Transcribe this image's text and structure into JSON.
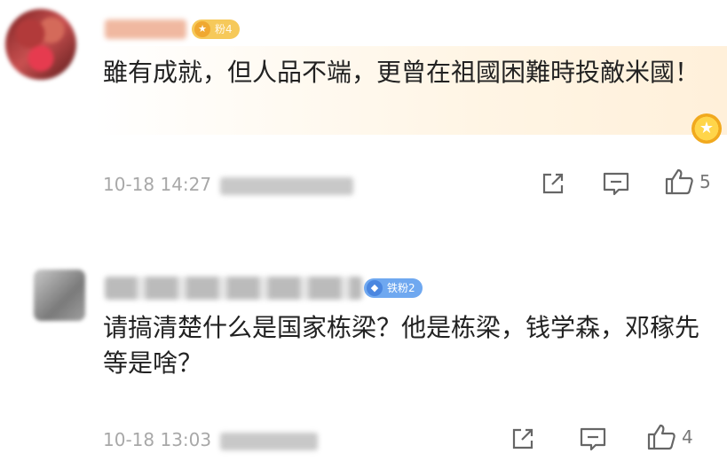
{
  "comments": [
    {
      "badge": "粉4",
      "text": "雖有成就，但人品不端，更曾在祖國困難時投敵米國！",
      "time": "10-18 14:27",
      "likes": "5"
    },
    {
      "badge": "铁粉2",
      "text": "请搞清楚什么是国家栋梁？他是栋梁，钱学森，邓稼先等是啥？",
      "time": "10-18 13:03",
      "likes": "4"
    }
  ],
  "icons": {
    "share": "share-icon",
    "reply": "comment-icon",
    "like": "thumbs-up-icon",
    "medal": "medal-icon"
  }
}
